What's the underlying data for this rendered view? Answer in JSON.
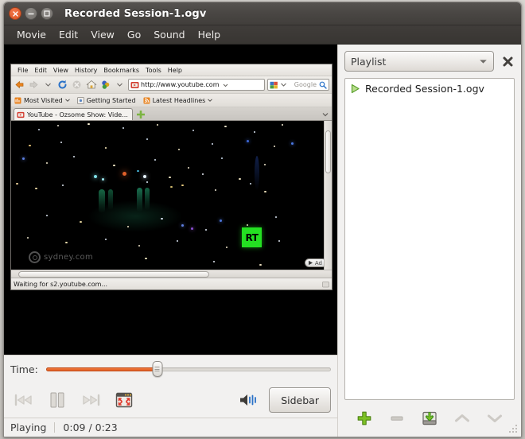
{
  "window": {
    "title": "Recorded Session-1.ogv",
    "buttons": {
      "close": "close",
      "minimize": "minimize",
      "maximize": "maximize"
    }
  },
  "menu": {
    "items": [
      "Movie",
      "Edit",
      "View",
      "Go",
      "Sound",
      "Help"
    ]
  },
  "browser": {
    "menu": [
      "File",
      "Edit",
      "View",
      "History",
      "Bookmarks",
      "Tools",
      "Help"
    ],
    "url": "http://www.youtube.com",
    "search_engine": "Google",
    "bookmarks": [
      "Most Visited",
      "Getting Started",
      "Latest Headlines"
    ],
    "tab_title": "YouTube - Ozsome Show: Vide...",
    "status": "Waiting for s2.youtube.com...",
    "icons": {
      "back": "back-arrow-icon",
      "forward": "forward-arrow-icon",
      "dropdown": "chevron-down-icon",
      "reload": "reload-icon",
      "stop": "stop-icon",
      "home": "home-icon",
      "feed": "feed-icon",
      "favicon": "youtube-favicon-icon",
      "search": "magnifier-icon",
      "newtab": "new-tab-plus-icon"
    }
  },
  "video": {
    "watermark": "sydney.com",
    "channel_logo": "RT",
    "ad_label": "Ad"
  },
  "controls": {
    "time_label": "Time:",
    "progress_percent": 39,
    "buttons": {
      "previous": "Previous",
      "play_pause": "Pause",
      "next": "Next",
      "fullscreen": "Fullscreen",
      "volume": "Volume",
      "sidebar": "Sidebar"
    }
  },
  "status": {
    "state": "Playing",
    "elapsed": "0:09",
    "duration": "0:23",
    "time_display": "0:09 / 0:23"
  },
  "playlist": {
    "selector_label": "Playlist",
    "close_label": "Close sidebar",
    "items": [
      {
        "title": "Recorded Session-1.ogv",
        "playing": true
      }
    ],
    "actions": {
      "add": "Add",
      "remove": "Remove",
      "save": "Save playlist",
      "move_up": "Move Up",
      "move_down": "Move Down"
    }
  },
  "colors": {
    "accent_orange": "#e05e24",
    "titlebar_dark": "#4a4744",
    "panel_gray": "#f2f1f0",
    "rt_green": "#24e022",
    "play_green": "#5aa02c"
  }
}
